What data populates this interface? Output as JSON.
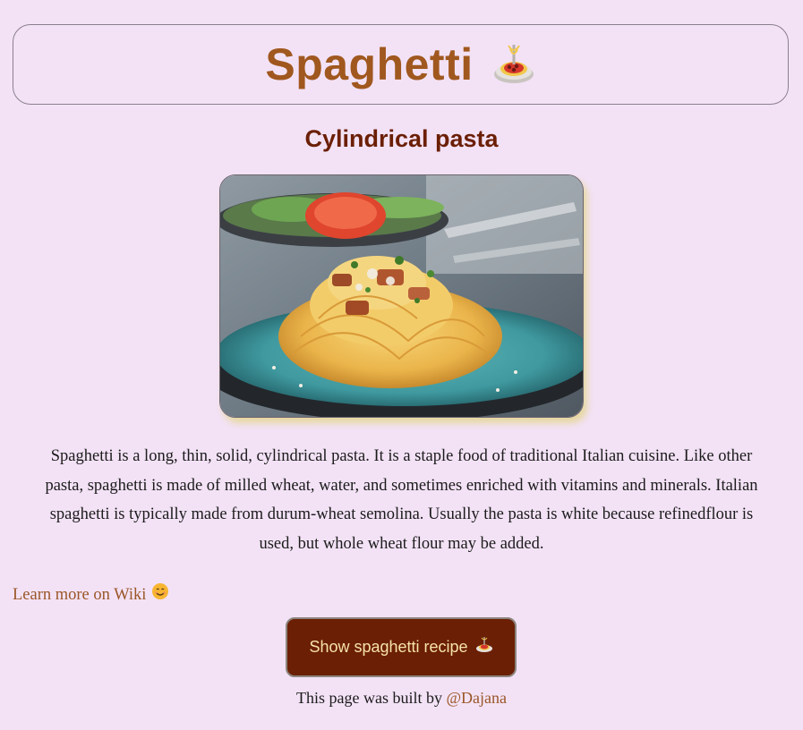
{
  "header": {
    "title": "Spaghetti",
    "emoji_icon": "spaghetti-icon"
  },
  "subtitle": "Cylindrical pasta",
  "photo": {
    "icon": "spaghetti-plate-photo"
  },
  "description": "Spaghetti is a long, thin, solid, cylindrical pasta. It is a staple food of traditional Italian cuisine. Like other pasta, spaghetti is made of milled wheat, water, and sometimes enriched with vitamins and minerals. Italian spaghetti is typically made from durum-wheat semolina. Usually the pasta is white because refinedflour is used, but whole wheat flour may be added.",
  "wiki_link": {
    "label": "Learn more on Wiki",
    "emoji_icon": "smiling-face-icon"
  },
  "recipe_button": {
    "label": "Show spaghetti recipe",
    "emoji_icon": "spaghetti-icon"
  },
  "footer": {
    "prefix": "This page was built by",
    "author": "@Dajana"
  },
  "colors": {
    "background": "#f3e2f6",
    "title": "#a0581f",
    "subtitle": "#6b1f05",
    "button_bg": "#6b1f05",
    "button_text": "#f6e2a8",
    "link": "#9a5627"
  }
}
